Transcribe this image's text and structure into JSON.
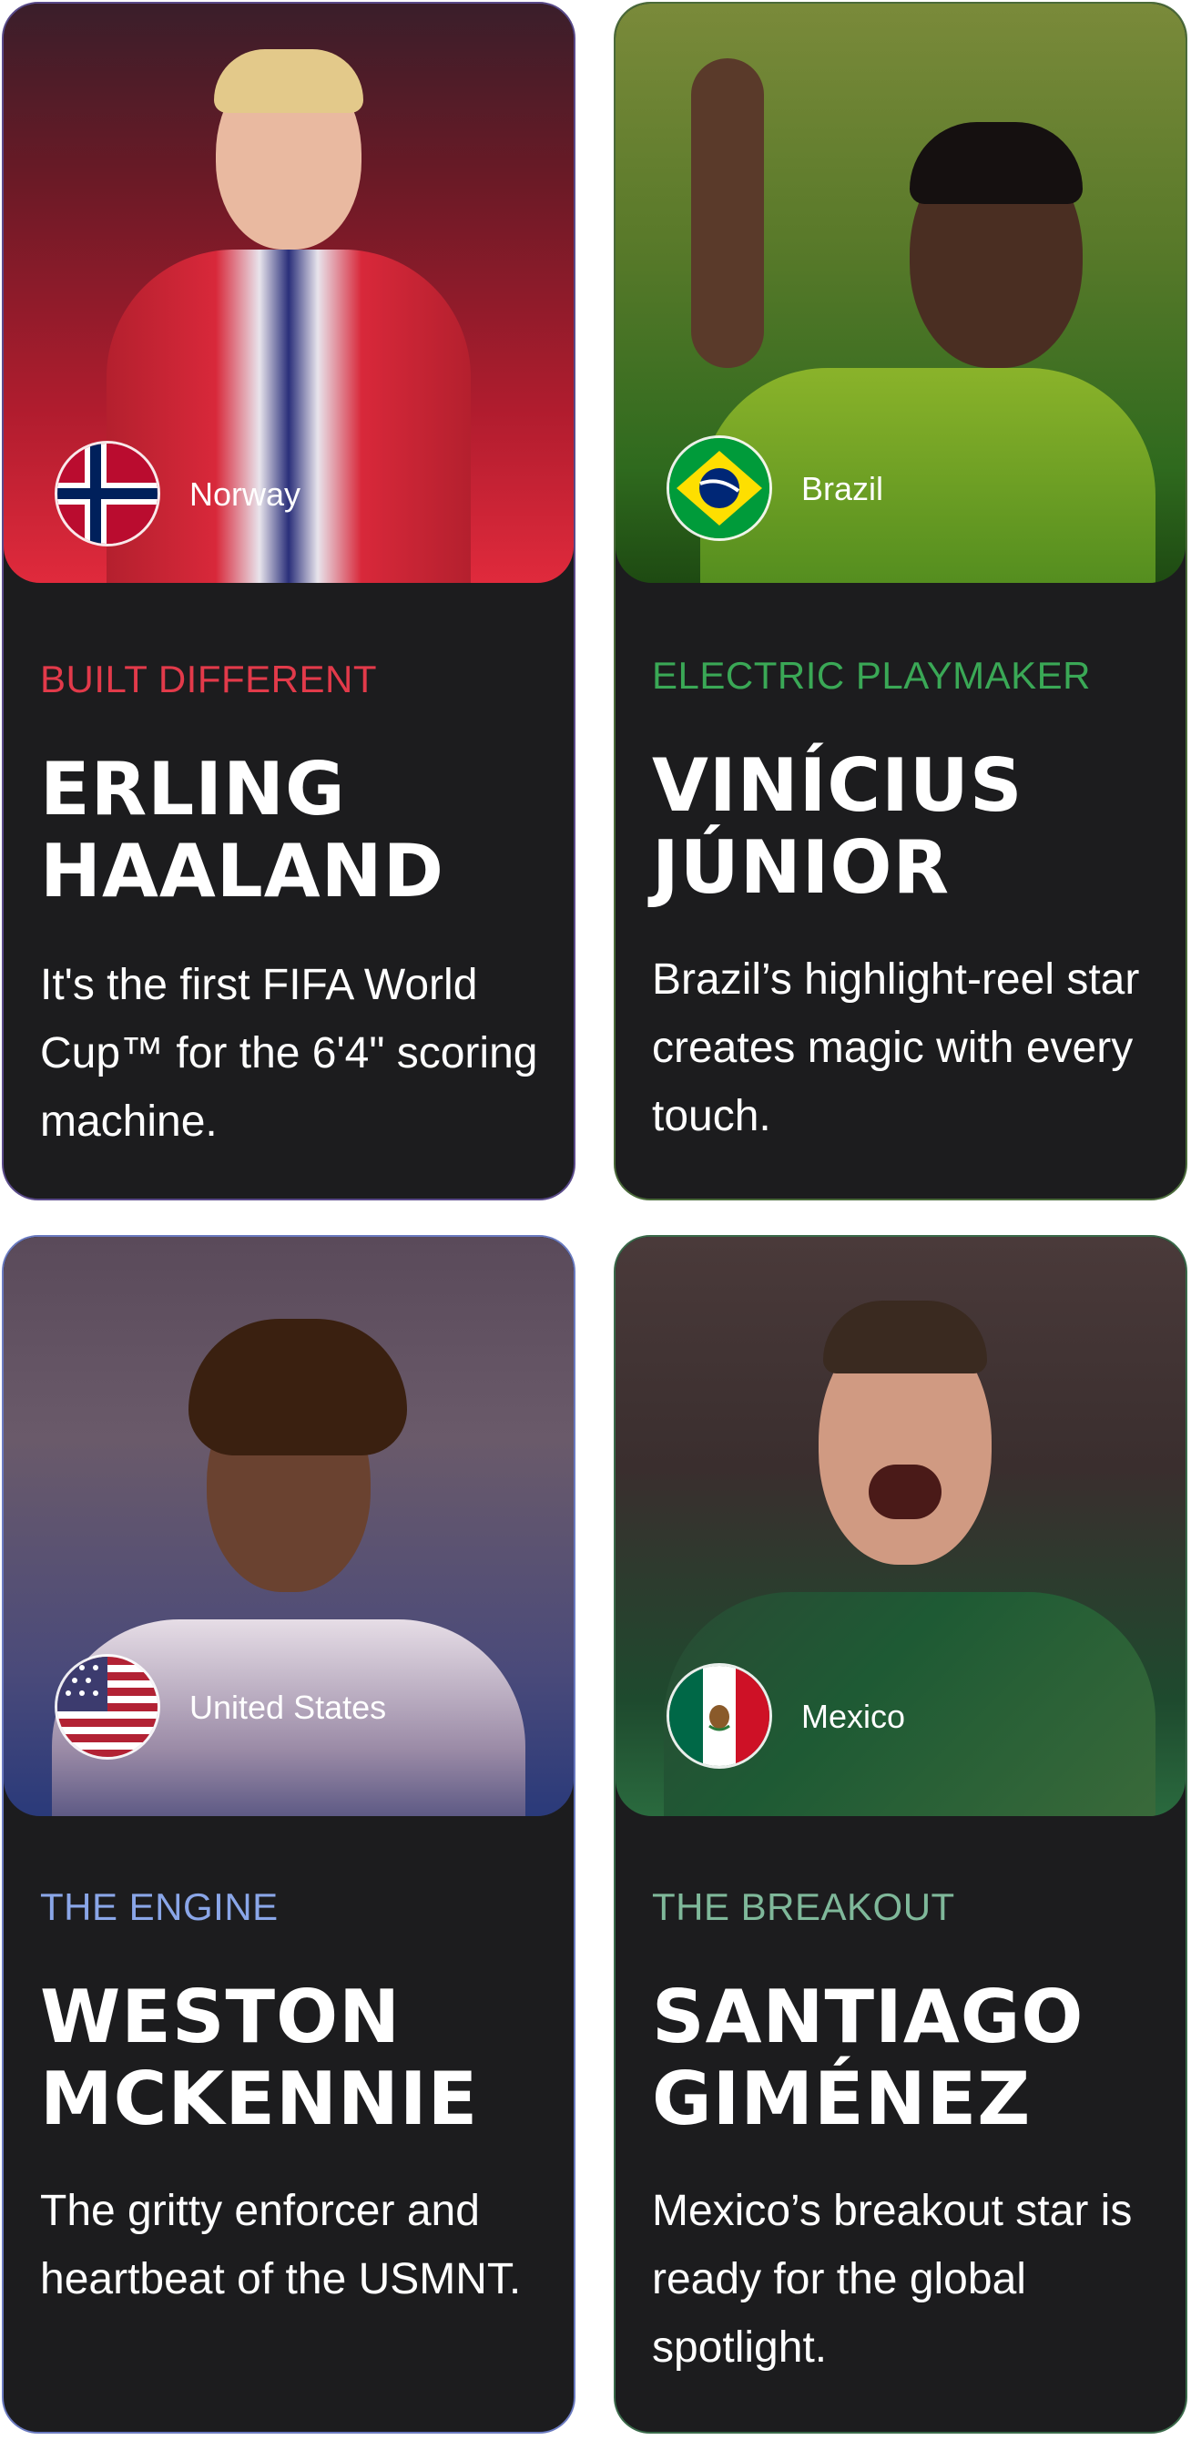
{
  "cards": [
    {
      "country": "Norway",
      "flag_icon": "norway-flag-icon",
      "tagline": "BUILT DIFFERENT",
      "tagline_color": "#e23a4a",
      "name": "ERLING\nHAALAND",
      "description": "It's the first FIFA World Cup™ for the 6'4\" scoring machine."
    },
    {
      "country": "Brazil",
      "flag_icon": "brazil-flag-icon",
      "tagline": "ELECTRIC PLAYMAKER",
      "tagline_color": "#3aa856",
      "name": "VINÍCIUS\nJÚNIOR",
      "description": "Brazil’s highlight-reel star creates magic with every touch."
    },
    {
      "country": "United States",
      "flag_icon": "usa-flag-icon",
      "tagline": "THE ENGINE",
      "tagline_color": "#8aa6e8",
      "name": "WESTON\nMCKENNIE",
      "description": "The gritty enforcer and heartbeat of the USMNT."
    },
    {
      "country": "Mexico",
      "flag_icon": "mexico-flag-icon",
      "tagline": "THE BREAKOUT",
      "tagline_color": "#7fb89a",
      "name": "SANTIAGO\nGIMÉNEZ",
      "description": "Mexico’s breakout star is ready for the global spotlight."
    }
  ]
}
